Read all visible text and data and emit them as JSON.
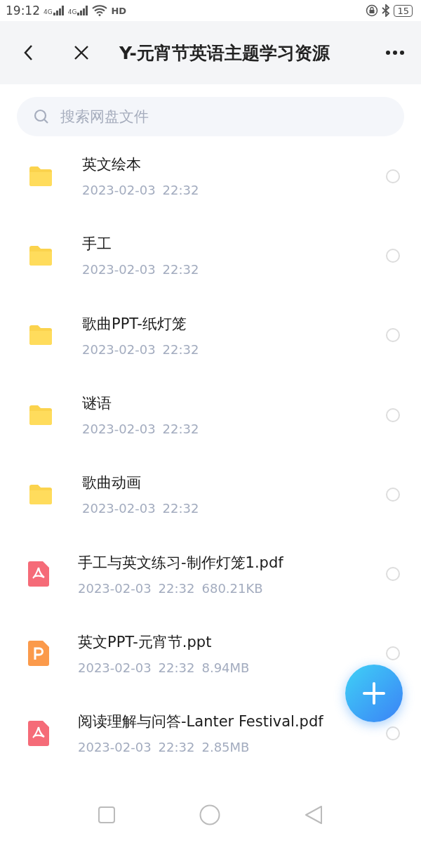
{
  "status_bar": {
    "time": "19:12",
    "signals": [
      "4G",
      "4G"
    ],
    "hd": "HD",
    "battery": "15"
  },
  "header": {
    "title": "Y-元宵节英语主题学习资源"
  },
  "search": {
    "placeholder": "搜索网盘文件"
  },
  "files": [
    {
      "kind": "folder",
      "name": "英文绘本",
      "date": "2023-02-03",
      "time": "22:32",
      "selected": false
    },
    {
      "kind": "folder",
      "name": "手工",
      "date": "2023-02-03",
      "time": "22:32",
      "selected": false
    },
    {
      "kind": "folder",
      "name": "歌曲PPT-纸灯笼",
      "date": "2023-02-03",
      "time": "22:32",
      "selected": false
    },
    {
      "kind": "folder",
      "name": "谜语",
      "date": "2023-02-03",
      "time": "22:32",
      "selected": false
    },
    {
      "kind": "folder",
      "name": "歌曲动画",
      "date": "2023-02-03",
      "time": "22:32",
      "selected": false
    },
    {
      "kind": "pdf",
      "name": "手工与英文练习-制作灯笼1.pdf",
      "date": "2023-02-03",
      "time": "22:32",
      "size": "680.21KB",
      "selected": false
    },
    {
      "kind": "ppt",
      "name": "英文PPT-元宵节.ppt",
      "date": "2023-02-03",
      "time": "22:32",
      "size": "8.94MB",
      "selected": false
    },
    {
      "kind": "pdf",
      "name": "阅读理解与问答-Lanter Festival.pdf",
      "date": "2023-02-03",
      "time": "22:32",
      "size": "2.85MB",
      "selected": false
    }
  ]
}
